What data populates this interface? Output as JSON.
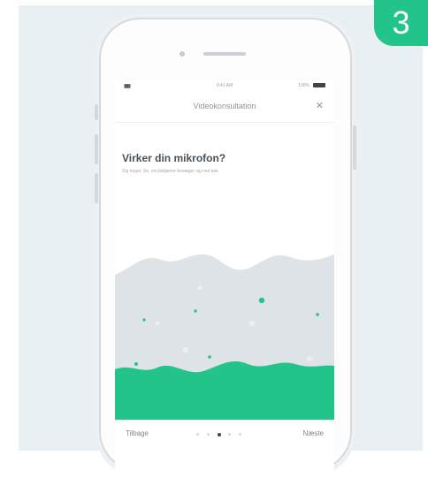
{
  "step_badge": "3",
  "status_bar": {
    "time": "9:41 AM",
    "battery": "100%"
  },
  "header": {
    "title": "Videokonsultation",
    "close_icon": "close-icon"
  },
  "content": {
    "question": "Virker din mikrofon?",
    "instruction": "Sig noget. Se, om bølgerne bevæger sig ved tale."
  },
  "footer": {
    "back_label": "Tilbage",
    "next_label": "Næste",
    "pages_total": 5,
    "current_page": 3
  },
  "colors": {
    "accent": "#22c48a",
    "wave_back": "#dde3e6",
    "text_dark": "#4a5258",
    "text_light": "#a3aab0",
    "panel_bg": "#e9f0f3"
  },
  "icons": [
    "close-icon",
    "signal-icon",
    "battery-icon"
  ]
}
